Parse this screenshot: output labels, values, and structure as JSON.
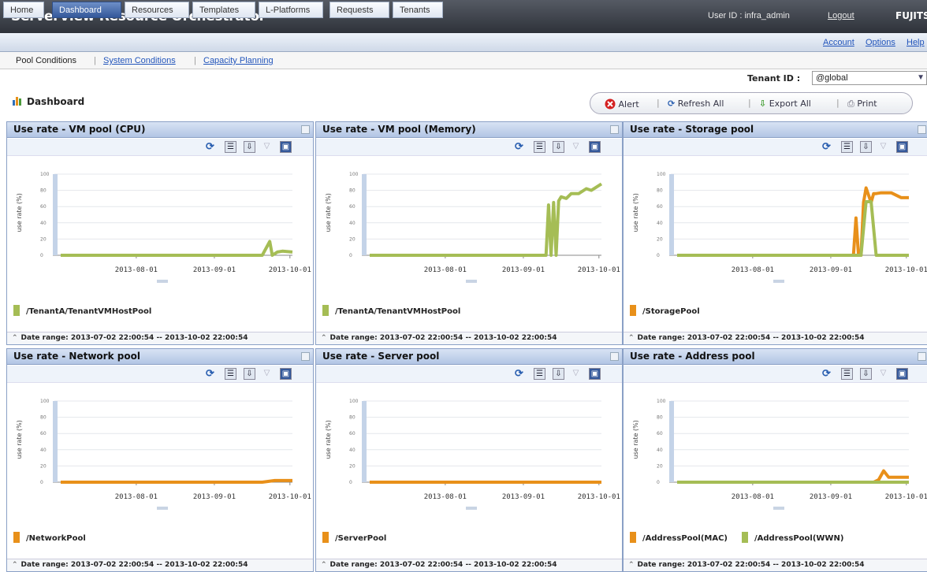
{
  "header": {
    "app_title": "ServerView Resource Orchestrator",
    "user_id": "User ID : infra_admin",
    "logout": "Logout",
    "logo": "FUJITSU"
  },
  "nav": {
    "tabs": [
      "Home",
      "Dashboard",
      "Resources",
      "Templates",
      "L-Platforms",
      "Requests",
      "Tenants"
    ],
    "active": "Dashboard",
    "right_links": [
      "Account",
      "Options",
      "Help"
    ]
  },
  "subnav": {
    "items": [
      "Pool Conditions",
      "System Conditions",
      "Capacity Planning"
    ]
  },
  "tenant": {
    "label": "Tenant ID :",
    "value": "@global"
  },
  "dashboard": {
    "title": "Dashboard"
  },
  "toolbar": {
    "alert": "Alert",
    "refresh_all": "Refresh All",
    "export_all": "Export All",
    "print": "Print"
  },
  "colors": {
    "orange": "#e8901a",
    "green": "#a5bd55",
    "header_bg": "#3a3f48",
    "accent": "#34589a"
  },
  "date_range_label": "Date range:",
  "date_range_value": "2013-07-02 22:00:54 -- 2013-10-02 22:00:54",
  "chart_data": [
    {
      "type": "line",
      "title": "Use rate - VM pool (CPU)",
      "ylabel": "use rate (%)",
      "ylim": [
        0,
        100
      ],
      "x_ticks": [
        "2013-08-01",
        "2013-09-01",
        "2013-10-01"
      ],
      "series": [
        {
          "name": "/TenantA/TenantVMHostPool",
          "color": "#a5bd55",
          "x": [
            "2013-07-02",
            "2013-09-20",
            "2013-09-23",
            "2013-09-24",
            "2013-09-26",
            "2013-09-28",
            "2013-10-02"
          ],
          "values": [
            0,
            0,
            17,
            0,
            4,
            5,
            4
          ]
        }
      ]
    },
    {
      "type": "line",
      "title": "Use rate - VM pool (Memory)",
      "ylabel": "use rate (%)",
      "ylim": [
        0,
        100
      ],
      "x_ticks": [
        "2013-08-01",
        "2013-09-01",
        "2013-10-01"
      ],
      "series": [
        {
          "name": "/TenantA/TenantVMHostPool",
          "color": "#a5bd55",
          "x": [
            "2013-07-02",
            "2013-09-10",
            "2013-09-11",
            "2013-09-12",
            "2013-09-13",
            "2013-09-14",
            "2013-09-15",
            "2013-09-16",
            "2013-09-18",
            "2013-09-20",
            "2013-09-23",
            "2013-09-26",
            "2013-09-28",
            "2013-10-02"
          ],
          "values": [
            0,
            0,
            62,
            0,
            65,
            0,
            67,
            72,
            70,
            76,
            76,
            82,
            80,
            88
          ]
        }
      ]
    },
    {
      "type": "line",
      "title": "Use rate - Storage pool",
      "ylabel": "use rate (%)",
      "ylim": [
        0,
        100
      ],
      "x_ticks": [
        "2013-08-01",
        "2013-09-01",
        "2013-10-01"
      ],
      "series": [
        {
          "name": "/StoragePool",
          "color": "#e8901a",
          "x": [
            "2013-07-02",
            "2013-09-10",
            "2013-09-11",
            "2013-09-12",
            "2013-09-13",
            "2013-09-14",
            "2013-09-15",
            "2013-09-17",
            "2013-09-18",
            "2013-09-19",
            "2013-09-21",
            "2013-09-25",
            "2013-09-29",
            "2013-10-02"
          ],
          "values": [
            0,
            0,
            46,
            0,
            0,
            65,
            83,
            65,
            76,
            76,
            77,
            77,
            71,
            71
          ]
        },
        {
          "color": "#a5bd55",
          "x": [
            "2013-07-02",
            "2013-09-13",
            "2013-09-15",
            "2013-09-17",
            "2013-09-19",
            "2013-10-02"
          ],
          "values": [
            0,
            0,
            66,
            66,
            0,
            0
          ]
        }
      ]
    },
    {
      "type": "line",
      "title": "Use rate - Network pool",
      "ylabel": "use rate (%)",
      "ylim": [
        0,
        100
      ],
      "x_ticks": [
        "2013-08-01",
        "2013-09-01",
        "2013-10-01"
      ],
      "series": [
        {
          "name": "/NetworkPool",
          "color": "#e8901a",
          "x": [
            "2013-07-02",
            "2013-09-20",
            "2013-09-25",
            "2013-10-02"
          ],
          "values": [
            0,
            0,
            2,
            2
          ]
        }
      ]
    },
    {
      "type": "line",
      "title": "Use rate - Server pool",
      "ylabel": "use rate (%)",
      "ylim": [
        0,
        100
      ],
      "x_ticks": [
        "2013-08-01",
        "2013-09-01",
        "2013-10-01"
      ],
      "series": [
        {
          "name": "/ServerPool",
          "color": "#e8901a",
          "x": [
            "2013-07-02",
            "2013-10-02"
          ],
          "values": [
            0,
            0
          ]
        }
      ]
    },
    {
      "type": "line",
      "title": "Use rate - Address pool",
      "ylabel": "use rate (%)",
      "ylim": [
        0,
        100
      ],
      "x_ticks": [
        "2013-08-01",
        "2013-09-01",
        "2013-10-01"
      ],
      "series": [
        {
          "name": "/AddressPool(MAC)",
          "color": "#e8901a",
          "x": [
            "2013-07-02",
            "2013-09-18",
            "2013-09-20",
            "2013-09-22",
            "2013-09-24",
            "2013-10-02"
          ],
          "values": [
            0,
            0,
            3,
            14,
            6,
            6
          ]
        },
        {
          "name": "/AddressPool(WWN)",
          "color": "#a5bd55",
          "x": [
            "2013-07-02",
            "2013-10-02"
          ],
          "values": [
            0,
            0
          ]
        }
      ]
    }
  ]
}
